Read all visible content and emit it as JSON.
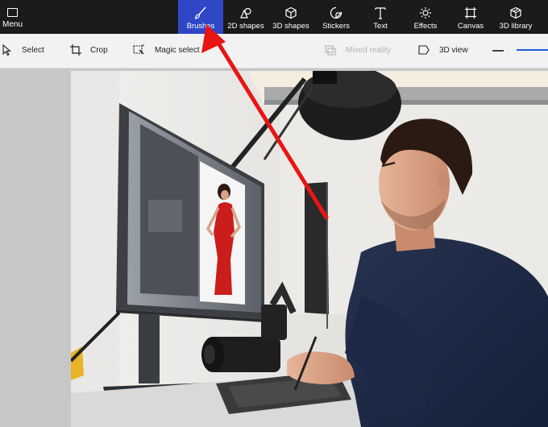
{
  "ribbon": {
    "menu_label": "Menu",
    "tabs": [
      {
        "label": "Brushes",
        "icon": "brush-icon",
        "active": true
      },
      {
        "label": "2D shapes",
        "icon": "2d-shapes-icon",
        "active": false
      },
      {
        "label": "3D shapes",
        "icon": "3d-cube-icon",
        "active": false
      },
      {
        "label": "Stickers",
        "icon": "sticker-icon",
        "active": false
      },
      {
        "label": "Text",
        "icon": "text-icon",
        "active": false
      },
      {
        "label": "Effects",
        "icon": "sun-icon",
        "active": false
      },
      {
        "label": "Canvas",
        "icon": "canvas-icon",
        "active": false
      },
      {
        "label": "3D library",
        "icon": "3d-library-icon",
        "active": false
      }
    ]
  },
  "toolbar": {
    "select_label": "Select",
    "crop_label": "Crop",
    "magic_select_label": "Magic select",
    "mixed_reality_label": "Mixed reality",
    "view_3d_label": "3D view"
  },
  "colors": {
    "ribbon_bg": "#1b1b1b",
    "active_tab": "#2f47c7",
    "toolbar_bg": "#f2f2f2",
    "workspace_bg": "#c7c7c7",
    "annotation_arrow": "#e81515",
    "zoom_accent": "#1f5bd6"
  }
}
